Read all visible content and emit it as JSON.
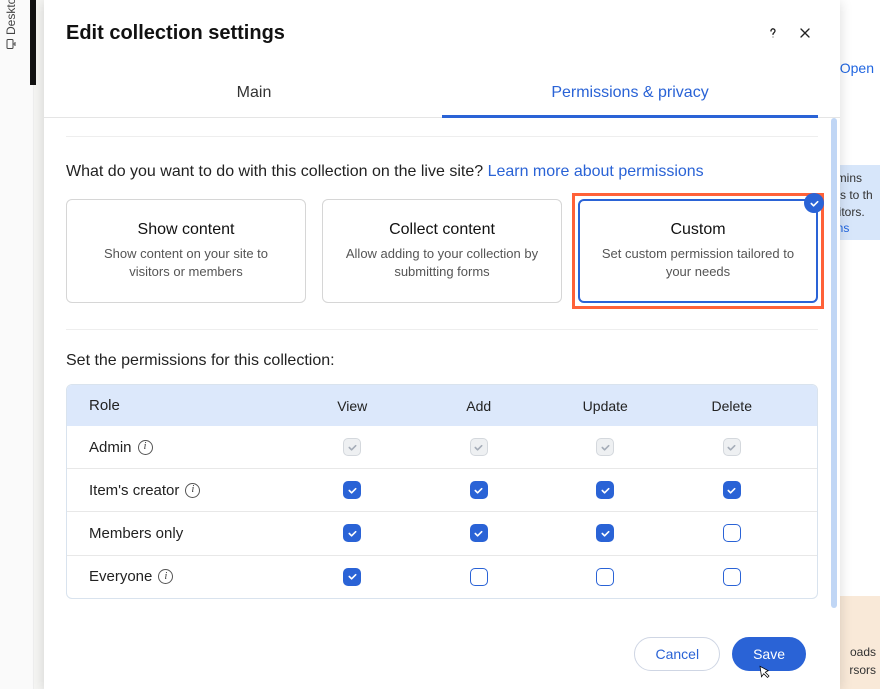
{
  "bg": {
    "left_label": "Desktop (Prima",
    "right_open": "Open",
    "right_tip_1": "dmins",
    "right_tip_2": "ms to th",
    "right_tip_3": "isitors.",
    "right_tip_link": "ons",
    "right_stub1": "oads",
    "right_stub2": "rsors"
  },
  "modal": {
    "title": "Edit collection settings",
    "tabs": {
      "main": "Main",
      "permissions": "Permissions & privacy"
    },
    "prompt_text": "What do you want to do with this collection on the live site? ",
    "prompt_link": "Learn more about permissions",
    "cards": [
      {
        "title": "Show content",
        "desc": "Show content on your site to visitors or members"
      },
      {
        "title": "Collect content",
        "desc": "Allow adding to your collection by submitting forms"
      },
      {
        "title": "Custom",
        "desc": "Set custom permission tailored to your needs"
      }
    ],
    "permissions": {
      "title": "Set the permissions for this collection:",
      "headers": {
        "role": "Role",
        "view": "View",
        "add": "Add",
        "update": "Update",
        "delete": "Delete"
      },
      "rows": [
        {
          "role": "Admin",
          "info": true,
          "cells": [
            "disabled",
            "disabled",
            "disabled",
            "disabled"
          ]
        },
        {
          "role": "Item's creator",
          "info": true,
          "cells": [
            "checked",
            "checked",
            "checked",
            "checked"
          ]
        },
        {
          "role": "Members only",
          "info": false,
          "cells": [
            "checked",
            "checked",
            "checked",
            "unchecked"
          ]
        },
        {
          "role": "Everyone",
          "info": true,
          "cells": [
            "checked",
            "unchecked",
            "unchecked",
            "unchecked"
          ]
        }
      ]
    },
    "footer": {
      "cancel": "Cancel",
      "save": "Save"
    }
  }
}
